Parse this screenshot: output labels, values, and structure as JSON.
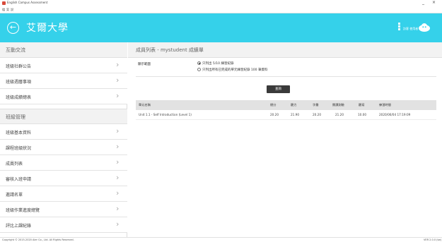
{
  "window": {
    "title": "English Campus Assessment",
    "menu": [
      "檔",
      "案",
      "說"
    ],
    "controls": [
      "_",
      "×"
    ]
  },
  "header": {
    "brand": "艾爾大學",
    "user_label": "訪客 使用者",
    "color": "#35d1ea"
  },
  "sidebar": {
    "section1": {
      "title": "互動交流",
      "items": [
        "班級社群公告",
        "班級週曆事項",
        "班級成績總表"
      ]
    },
    "section2": {
      "title": "班級管理",
      "items": [
        "班級基本資料",
        "課程班級狀況",
        "成員列表",
        "審核入班申請",
        "邀請名單",
        "班級作業進度總覽",
        "評比上課紀錄"
      ]
    }
  },
  "main": {
    "page_title": "成員列表 - mystudent 成績單",
    "options": {
      "label": "顯示範圍",
      "radio1": "只列出 5/10 練習紀錄",
      "radio2": "只列出所有已完成的單元練習紀錄 100 筆資料",
      "selected": 1
    },
    "search_button": "查詢",
    "table": {
      "headers": [
        "單元名稱",
        "總分",
        "聽力",
        "字彙",
        "閱讀測驗",
        "聽寫",
        "練習時間"
      ],
      "rows": [
        [
          "Unit 1.1 - Self Introduction (Level 1)",
          "20.20",
          "21.90",
          "20.20",
          "21.20",
          "10.00",
          "2020/06/04 17:19:09"
        ]
      ]
    }
  },
  "footer": {
    "copyright": "Copyright © 2015-2020 Aier Co., Ltd. All Rights Reserved.",
    "version": "VER 2.0.0 (tw)"
  }
}
